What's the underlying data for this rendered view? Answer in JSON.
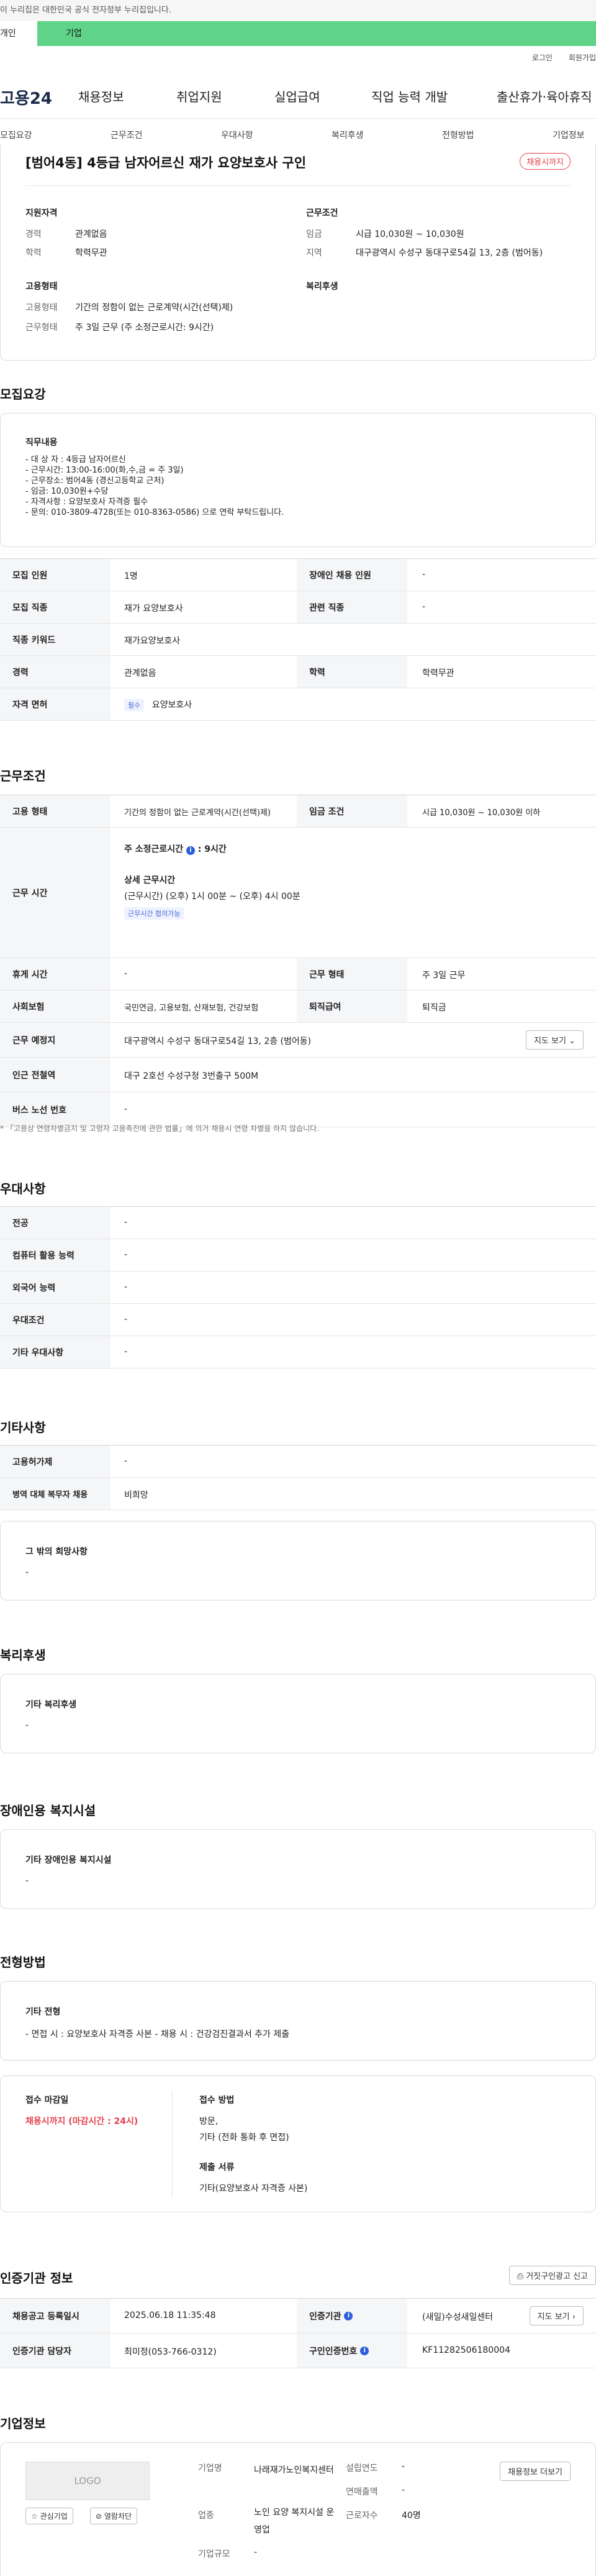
{
  "notice": "이 누리집은 대한민국 공식 전자정부 누리집입니다.",
  "user_tabs": [
    "개인",
    "기업"
  ],
  "top_links": [
    "로그인",
    "회원가입"
  ],
  "gnb": {
    "logo": "고용24",
    "menu": [
      "채용정보",
      "취업지원",
      "실업급여",
      "직업 능력 개발",
      "출산휴가·육아휴직"
    ]
  },
  "section_nav": [
    "모집요강",
    "근무조건",
    "우대사항",
    "복리후생",
    "전형방법",
    "기업정보"
  ],
  "summary": {
    "title": "[범어4동] 4등급 남자어르신 재가 요양보호사 구인",
    "badge": "채용시까지",
    "qualify_heading": "지원자격",
    "career_label": "경력",
    "career_value": "관계없음",
    "edu_label": "학력",
    "edu_value": "학력무관",
    "cond_heading": "근무조건",
    "wage_label": "임금",
    "wage_value": "시급 10,030원 ~ 10,030원",
    "region_label": "지역",
    "region_value": "대구광역시 수성구 동대구로54길 13, 2층 (범어동)",
    "emp_heading": "고용형태",
    "emp_type_label": "고용형태",
    "emp_type_value": "기간의 정함이 없는 근로계약(시간(선택)제)",
    "work_form_label": "근무형태",
    "work_form_value": "주 3일 근무 (주 소정근로시간: 9시간)",
    "welfare_heading": "복리후생"
  },
  "recruit": {
    "heading": "모집요강",
    "job_desc_label": "직무내용",
    "job_desc": "- 대 상 자 : 4등급 남자어르신\n- 근무시간: 13:00-16:00(화,수,금 = 주 3일)\n- 근무장소: 범어4동 (경신고등학교 근처)\n- 임금: 10,030원+수당\n- 자격사항 : 요양보호사 자격증 필수\n- 문의: 010-3809-4728(또는 010-8363-0586) 으로 연락 부탁드립니다.",
    "rows": {
      "count_label": "모집 인원",
      "count_value": "1명",
      "disabled_label": "장애인 채용 인원",
      "disabled_value": "-",
      "job_label": "모집 직종",
      "job_value": "재가 요양보호사",
      "related_label": "관련 직종",
      "related_value": "-",
      "keyword_label": "직종 키워드",
      "keyword_value": "재가요양보호사",
      "career_label": "경력",
      "career_value": "관계없음",
      "edu_label": "학력",
      "edu_value": "학력무관",
      "license_label": "자격 면허",
      "license_chip": "필수",
      "license_value": "요양보호사"
    }
  },
  "conditions": {
    "heading": "근무조건",
    "emp_label": "고용 형태",
    "emp_value": "기간의 정함이 없는 근로계약(시간(선택)제)",
    "wage_label": "임금 조건",
    "wage_value": "시급 10,030원 ~ 10,030원 이하",
    "hours_label": "근무 시간",
    "weekly_hours_label": "주 소정근로시간",
    "weekly_hours_value": ": 9시간",
    "detail_label": "상세 근무시간",
    "detail_value": "(근무시간) (오후) 1시 00분 ~ (오후) 4시 00분",
    "detail_chip": "근무시간 협의가능",
    "holiday_label": "휴게 시간",
    "holiday_value": "-",
    "work_type_label": "근무 형태",
    "work_type_value": "주 3일 근무",
    "insurance_label": "사회보험",
    "insurance_value": "국민연금, 고용보험, 산재보험, 건강보험",
    "retire_label": "퇴직급여",
    "retire_value": "퇴직금",
    "place_label": "근무 예정지",
    "place_value": "대구광역시 수성구 동대구로54길 13, 2층 (범어동)",
    "map_btn": "지도 보기",
    "station_label": "인근 전철역",
    "station_value": "대구 2호선 수성구청 3번출구 500M",
    "bus_label": "버스 노선 번호",
    "bus_value": "-",
    "footnote": "* 「고용상 연령차별금지 및 고령자 고용촉진에 관한 법률」에 의거 채용시 연령 차별을 하지 않습니다."
  },
  "preference": {
    "heading": "우대사항",
    "rows": [
      {
        "label": "전공",
        "value": "-"
      },
      {
        "label": "컴퓨터 활용 능력",
        "value": "-"
      },
      {
        "label": "외국어 능력",
        "value": "-"
      },
      {
        "label": "우대조건",
        "value": "-"
      },
      {
        "label": "기타 우대사항",
        "value": "-"
      }
    ]
  },
  "etc": {
    "heading": "기타사항",
    "rows": [
      {
        "label": "고용허가제",
        "value": "-"
      },
      {
        "label": "병역 대체 복무자 채용",
        "value": "비희망"
      }
    ],
    "other_label": "그 밖의 희망사항",
    "other_value": "-"
  },
  "welfare": {
    "heading": "복리후생",
    "label": "기타 복리후생",
    "value": "-"
  },
  "disabled_fac": {
    "heading": "장애인용 복지시설",
    "label": "기타 장애인용 복지시설",
    "value": "-"
  },
  "selection": {
    "heading": "전형방법",
    "etc_label": "기타 전형",
    "etc_value": "- 면접 시 : 요양보호사 자격증 사본 - 채용 시 : 건강검진결과서 추가 제출",
    "deadline_label": "접수 마감일",
    "deadline_value": "채용시까지 (마감시간 : 24시)",
    "method_label": "접수 방법",
    "method_value": "방문,\n기타 (전화 통화 후 면접)",
    "docs_label": "제출 서류",
    "docs_value": "기타(요양보호사 자격증 사본)"
  },
  "cert": {
    "heading": "인증기관 정보",
    "report_btn": "거짓구인광고 신고",
    "reg_label": "채용공고 등록일시",
    "reg_value": "2025.06.18 11:35:48",
    "org_label": "인증기관",
    "org_value": "(새일)수성새일센터",
    "map_btn": "지도 보기",
    "manager_label": "인증기관 담당자",
    "manager_value": "최미정(053-766-0312)",
    "cert_no_label": "구인인증번호",
    "cert_no_value": "KF11282506180004"
  },
  "company": {
    "heading": "기업정보",
    "logo_text": "LOGO",
    "fav_btn": "관심기업",
    "block_btn": "열람차단",
    "name_label": "기업명",
    "name_value": "나래재가노인복지센터",
    "industry_label": "업종",
    "industry_value": "노인 요양 복지시설 운영업",
    "size_label": "기업규모",
    "size_value": "-",
    "founded_label": "설립연도",
    "founded_value": "-",
    "sales_label": "연매출액",
    "sales_value": "-",
    "employees_label": "근로자수",
    "employees_value": "40명",
    "jobs_btn": "채용정보 더보기"
  }
}
